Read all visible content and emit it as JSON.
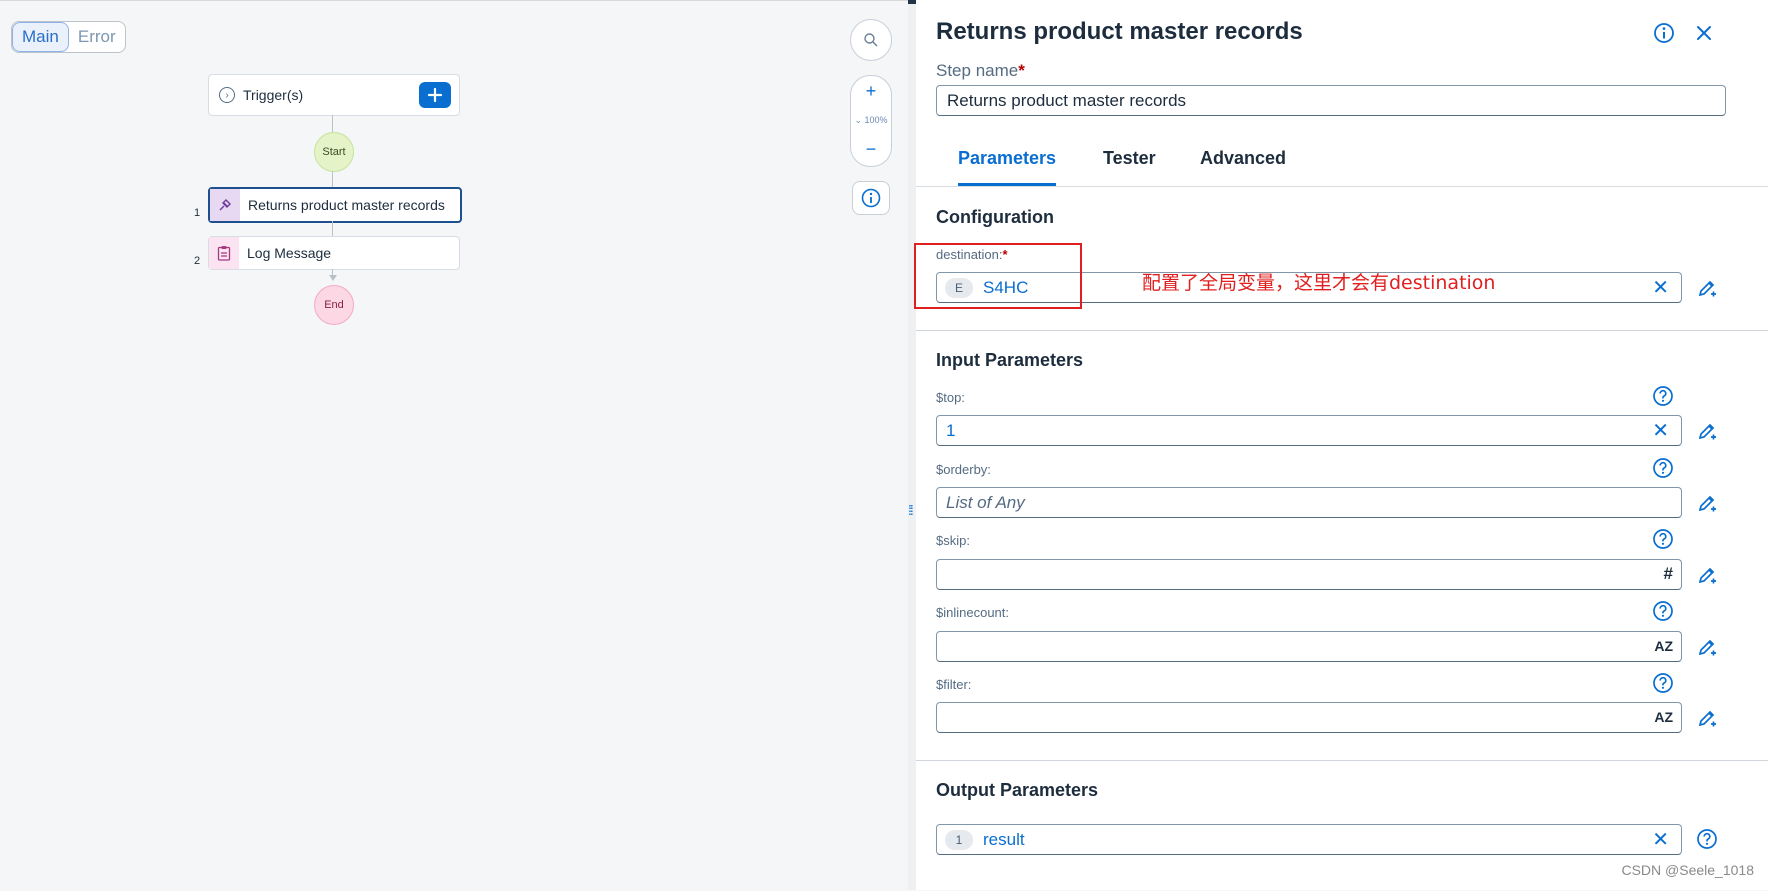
{
  "canvas": {
    "tabs": [
      {
        "label": "Main",
        "active": true
      },
      {
        "label": "Error",
        "active": false
      }
    ],
    "trigger": {
      "label": "Trigger(s)",
      "add_icon": "plus-icon"
    },
    "start_label": "Start",
    "end_label": "End",
    "steps": [
      {
        "number": "1",
        "label": "Returns product master records",
        "icon": "action-icon",
        "selected": true
      },
      {
        "number": "2",
        "label": "Log Message",
        "icon": "clipboard-icon",
        "selected": false
      }
    ],
    "zoom": {
      "in": "+",
      "level": "100%",
      "out": "−"
    }
  },
  "panel": {
    "title": "Returns product master records",
    "step_name_label": "Step name",
    "step_name_value": "Returns product master records",
    "tabs": [
      "Parameters",
      "Tester",
      "Advanced"
    ],
    "active_tab": "Parameters",
    "configuration": {
      "title": "Configuration",
      "destination_label": "destination:",
      "destination_chip": "E",
      "destination_value": "S4HC"
    },
    "input_parameters": {
      "title": "Input Parameters",
      "fields": [
        {
          "label": "$top:",
          "value": "1",
          "placeholder": "",
          "type_icon": "clear"
        },
        {
          "label": "$orderby:",
          "value": "",
          "placeholder": "List of Any",
          "type_icon": "none"
        },
        {
          "label": "$skip:",
          "value": "",
          "placeholder": "",
          "type_icon": "#"
        },
        {
          "label": "$inlinecount:",
          "value": "",
          "placeholder": "",
          "type_icon": "AZ"
        },
        {
          "label": "$filter:",
          "value": "",
          "placeholder": "",
          "type_icon": "AZ"
        }
      ]
    },
    "output_parameters": {
      "title": "Output Parameters",
      "chip": "1",
      "value": "result"
    }
  },
  "annotation": {
    "text": "配置了全局变量，这里才会有destination",
    "color": "#e02020"
  },
  "watermark": "CSDN @Seele_1018",
  "colors": {
    "accent": "#0a6ed1",
    "required": "#bb0000"
  }
}
